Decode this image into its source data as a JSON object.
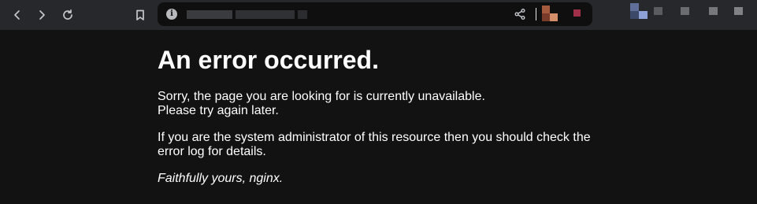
{
  "browser": {
    "back_icon": "chevron-left-icon",
    "forward_icon": "chevron-right-icon",
    "reload_icon": "reload-icon",
    "bookmark_icon": "bookmark-icon",
    "site_info_icon": "info-icon",
    "share_icon": "share-icon",
    "info_glyph": "i"
  },
  "page": {
    "title": "An error occurred.",
    "message_line1": "Sorry, the page you are looking for is currently unavailable.",
    "message_line2": "Please try again later.",
    "admin_note": "If you are the system administrator of this resource then you should check the error log for details.",
    "signature": "Faithfully yours, nginx."
  }
}
